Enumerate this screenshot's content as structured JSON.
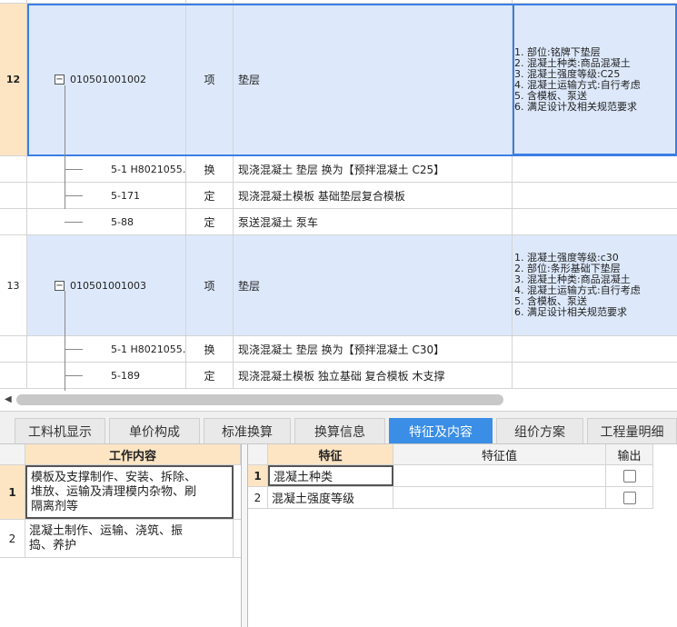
{
  "grid": {
    "rows": [
      {
        "no": "12",
        "code": "010501001002",
        "type": "项",
        "name": "垫层",
        "features": "1. 部位:铭牌下垫层\n2. 混凝土种类:商品混凝土\n3. 混凝土强度等级:C25\n4. 混凝土运输方式:自行考虑\n5. 含模板、泵送\n6. 满足设计及相关规范要求"
      },
      {
        "code": "5-1 H8021055…",
        "type": "换",
        "name": "现浇混凝土 垫层  换为【预拌混凝土 C25】"
      },
      {
        "code": "5-171",
        "type": "定",
        "name": "现浇混凝土模板 基础垫层复合模板"
      },
      {
        "code": "5-88",
        "type": "定",
        "name": "泵送混凝土 泵车"
      },
      {
        "no": "13",
        "code": "010501001003",
        "type": "项",
        "name": "垫层",
        "features": "1. 混凝土强度等级:c30\n2. 部位:条形基础下垫层\n3. 混凝土种类:商品混凝土\n4. 混凝土运输方式:自行考虑\n5. 含模板、泵送\n6. 满足设计相关规范要求"
      },
      {
        "code": "5-1 H8021055…",
        "type": "换",
        "name": "现浇混凝土 垫层  换为【预拌混凝土 C30】"
      },
      {
        "code": "5-189",
        "type": "定",
        "name": "现浇混凝土模板 独立基础 复合模板 木支撑"
      }
    ]
  },
  "tabs": [
    "工料机显示",
    "单价构成",
    "标准换算",
    "换算信息",
    "特征及内容",
    "组价方案",
    "工程量明细"
  ],
  "active_tab": "特征及内容",
  "accent_color": "#3a8ee6",
  "work_content": {
    "header": "工作内容",
    "rows": [
      {
        "no": "1",
        "text": "模板及支撑制作、安装、拆除、\n堆放、运输及清理模内杂物、刷\n隔离剂等"
      },
      {
        "no": "2",
        "text": "混凝土制作、运输、浇筑、振\n捣、养护"
      }
    ]
  },
  "features_table": {
    "headers": {
      "feature": "特征",
      "value": "特征值",
      "output": "输出"
    },
    "rows": [
      {
        "no": "1",
        "feature": "混凝土种类",
        "value": ""
      },
      {
        "no": "2",
        "feature": "混凝土强度等级",
        "value": ""
      }
    ]
  }
}
